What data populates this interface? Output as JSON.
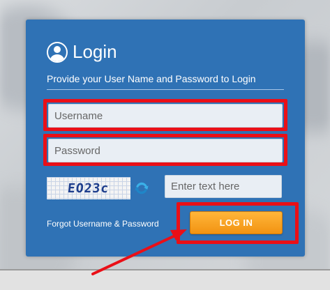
{
  "login": {
    "title": "Login",
    "subtitle": "Provide your User Name and Password to Login",
    "username_placeholder": "Username",
    "password_placeholder": "Password",
    "captcha_text": "EO23c",
    "captcha_input_placeholder": "Enter text here",
    "forgot_link": "Forgot Username & Password",
    "login_button": "LOG IN"
  },
  "icons": {
    "user": "user-icon",
    "refresh": "refresh-icon"
  },
  "colors": {
    "card": "#2f72b5",
    "highlight": "#ea0f17",
    "login_button": "#f29312"
  }
}
